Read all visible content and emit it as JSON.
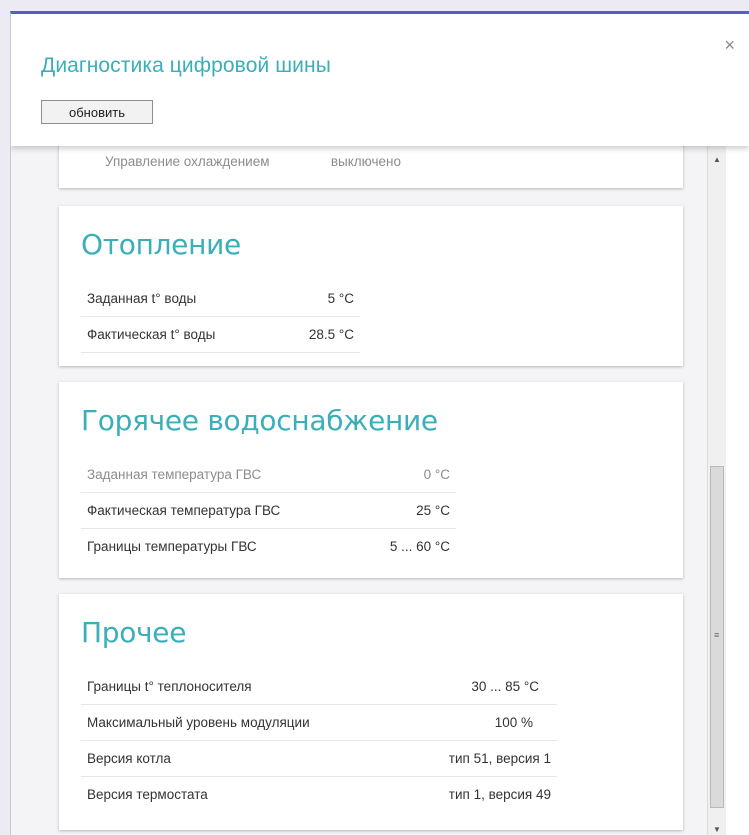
{
  "dialog": {
    "title": "Диагностика цифровой шины",
    "refresh_label": "обновить",
    "close_glyph": "×"
  },
  "partial_row": {
    "label": "Управление охлаждением",
    "value": "выключено"
  },
  "heating": {
    "title": "Отопление",
    "rows": [
      {
        "label": "Заданная t° воды",
        "value": "5   °C"
      },
      {
        "label": "Фактическая t° воды",
        "value": "28.5 °C"
      }
    ]
  },
  "hot_water": {
    "title": "Горячее водоснабжение",
    "rows": [
      {
        "label": "Заданная температура ГВС",
        "value": "0 °C"
      },
      {
        "label": "Фактическая температура ГВС",
        "value": "25 °C"
      },
      {
        "label": "Границы температуры ГВС",
        "value": "5 ... 60 °C"
      }
    ]
  },
  "other": {
    "title": "Прочее",
    "rows": [
      {
        "label": "Границы t° теплоносителя",
        "value": "30 ... 85 °C"
      },
      {
        "label": "Максимальный уровень модуляции",
        "value": "100 %"
      },
      {
        "label": "Версия котла",
        "value": "тип 51, версия 1"
      },
      {
        "label": "Версия термостата",
        "value": "тип 1, версия 49"
      }
    ]
  },
  "colors": {
    "accent": "#3aafb9",
    "window_border": "#4a63c8",
    "muted_text": "#8c8c8c"
  }
}
